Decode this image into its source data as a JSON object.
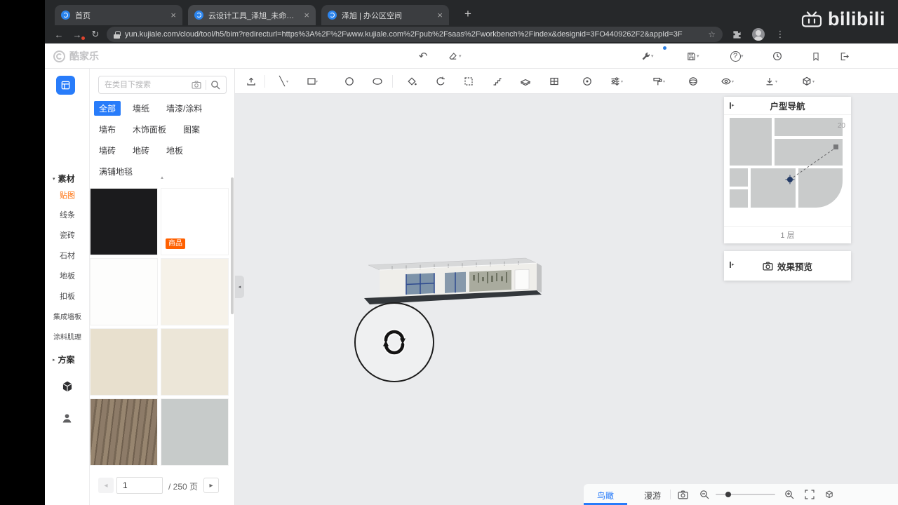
{
  "icons": {
    "close": "×",
    "plus": "+",
    "chevron_down": "▾",
    "caret_down": "▾",
    "caret_right": "▸",
    "caret_up": "▴",
    "back": "←",
    "forward": "→",
    "reload": "↻",
    "undo": "↶",
    "star": "☆",
    "dots": "⋮",
    "line": "╲",
    "prev": "◂",
    "next": "▸",
    "collapse_left": "◂",
    "help": "?"
  },
  "browser": {
    "tabs": [
      {
        "title": "首页",
        "active": false
      },
      {
        "title": "云设计工具_泽旭_未命名方案",
        "active": true
      },
      {
        "title": "泽旭 | 办公区空间",
        "active": false
      }
    ],
    "url": "yun.kujiale.com/cloud/tool/h5/bim?redirecturl=https%3A%2F%2Fwww.kujiale.com%2Fpub%2Fsaas%2Fworkbench%2Findex&designid=3FO4409262F2&appId=3F",
    "watermark": "bilibili"
  },
  "header": {
    "brand": "酷家乐"
  },
  "rail": {
    "sections": {
      "material": "素材",
      "plan": "方案"
    },
    "items": [
      {
        "label": "贴图",
        "active": true
      },
      {
        "label": "线条"
      },
      {
        "label": "瓷砖"
      },
      {
        "label": "石材"
      },
      {
        "label": "地板"
      },
      {
        "label": "扣板"
      },
      {
        "label": "集成墙板"
      },
      {
        "label": "涂料肌理"
      }
    ]
  },
  "materials": {
    "search_placeholder": "在类目下搜索",
    "categories": [
      {
        "label": "全部",
        "active": true
      },
      {
        "label": "墙纸"
      },
      {
        "label": "墙漆/涂料"
      },
      {
        "label": "墙布"
      },
      {
        "label": "木饰面板"
      },
      {
        "label": "图案"
      },
      {
        "label": "墙砖"
      },
      {
        "label": "地砖"
      },
      {
        "label": "地板"
      },
      {
        "label": "满铺地毯"
      }
    ],
    "swatches": [
      {
        "name": "black-material",
        "color": "#1b1b1d"
      },
      {
        "name": "white-material",
        "color": "#ffffff",
        "badge": "商品"
      },
      {
        "name": "white-material-2",
        "color": "#fdfdfc"
      },
      {
        "name": "ivory-material",
        "color": "#f6f2e9"
      },
      {
        "name": "cream-material",
        "color": "#e8e0ce"
      },
      {
        "name": "light-cream-material",
        "color": "#ece6d8"
      },
      {
        "name": "walnut-wood-material",
        "color": "#8d7b68",
        "css": "repeating-linear-gradient(97deg,#8d7b68 0px,#8d7b68 7px,#776755 7px,#776755 10px,#97856f 10px,#97856f 16px,#6f5f4e 16px,#6f5f4e 18px)"
      },
      {
        "name": "grey-material",
        "color": "#c7cbca"
      }
    ],
    "pagination": {
      "page": "1",
      "total": "/ 250 页"
    }
  },
  "canvas": {
    "toolbar_tools": [
      "import",
      "line",
      "rectangle",
      "circle",
      "ellipse",
      "paint-bucket",
      "rotate",
      "region-select",
      "stairs",
      "platform",
      "opening",
      "component",
      "adjust",
      "paint-roller",
      "sphere",
      "visibility",
      "export",
      "view-mode"
    ]
  },
  "nav_panel": {
    "title": "户型导航",
    "zoom_value": "20",
    "floor": "1 层"
  },
  "preview_panel": {
    "title": "效果预览"
  },
  "viewbar": {
    "tabs": [
      {
        "label": "鸟瞰",
        "active": true
      },
      {
        "label": "漫游",
        "active": false
      }
    ]
  },
  "colors": {
    "accent_blue": "#287cfa",
    "active_orange": "#ff6a00",
    "badge_orange": "#ff6000",
    "canvas_grey": "#eaebed"
  }
}
